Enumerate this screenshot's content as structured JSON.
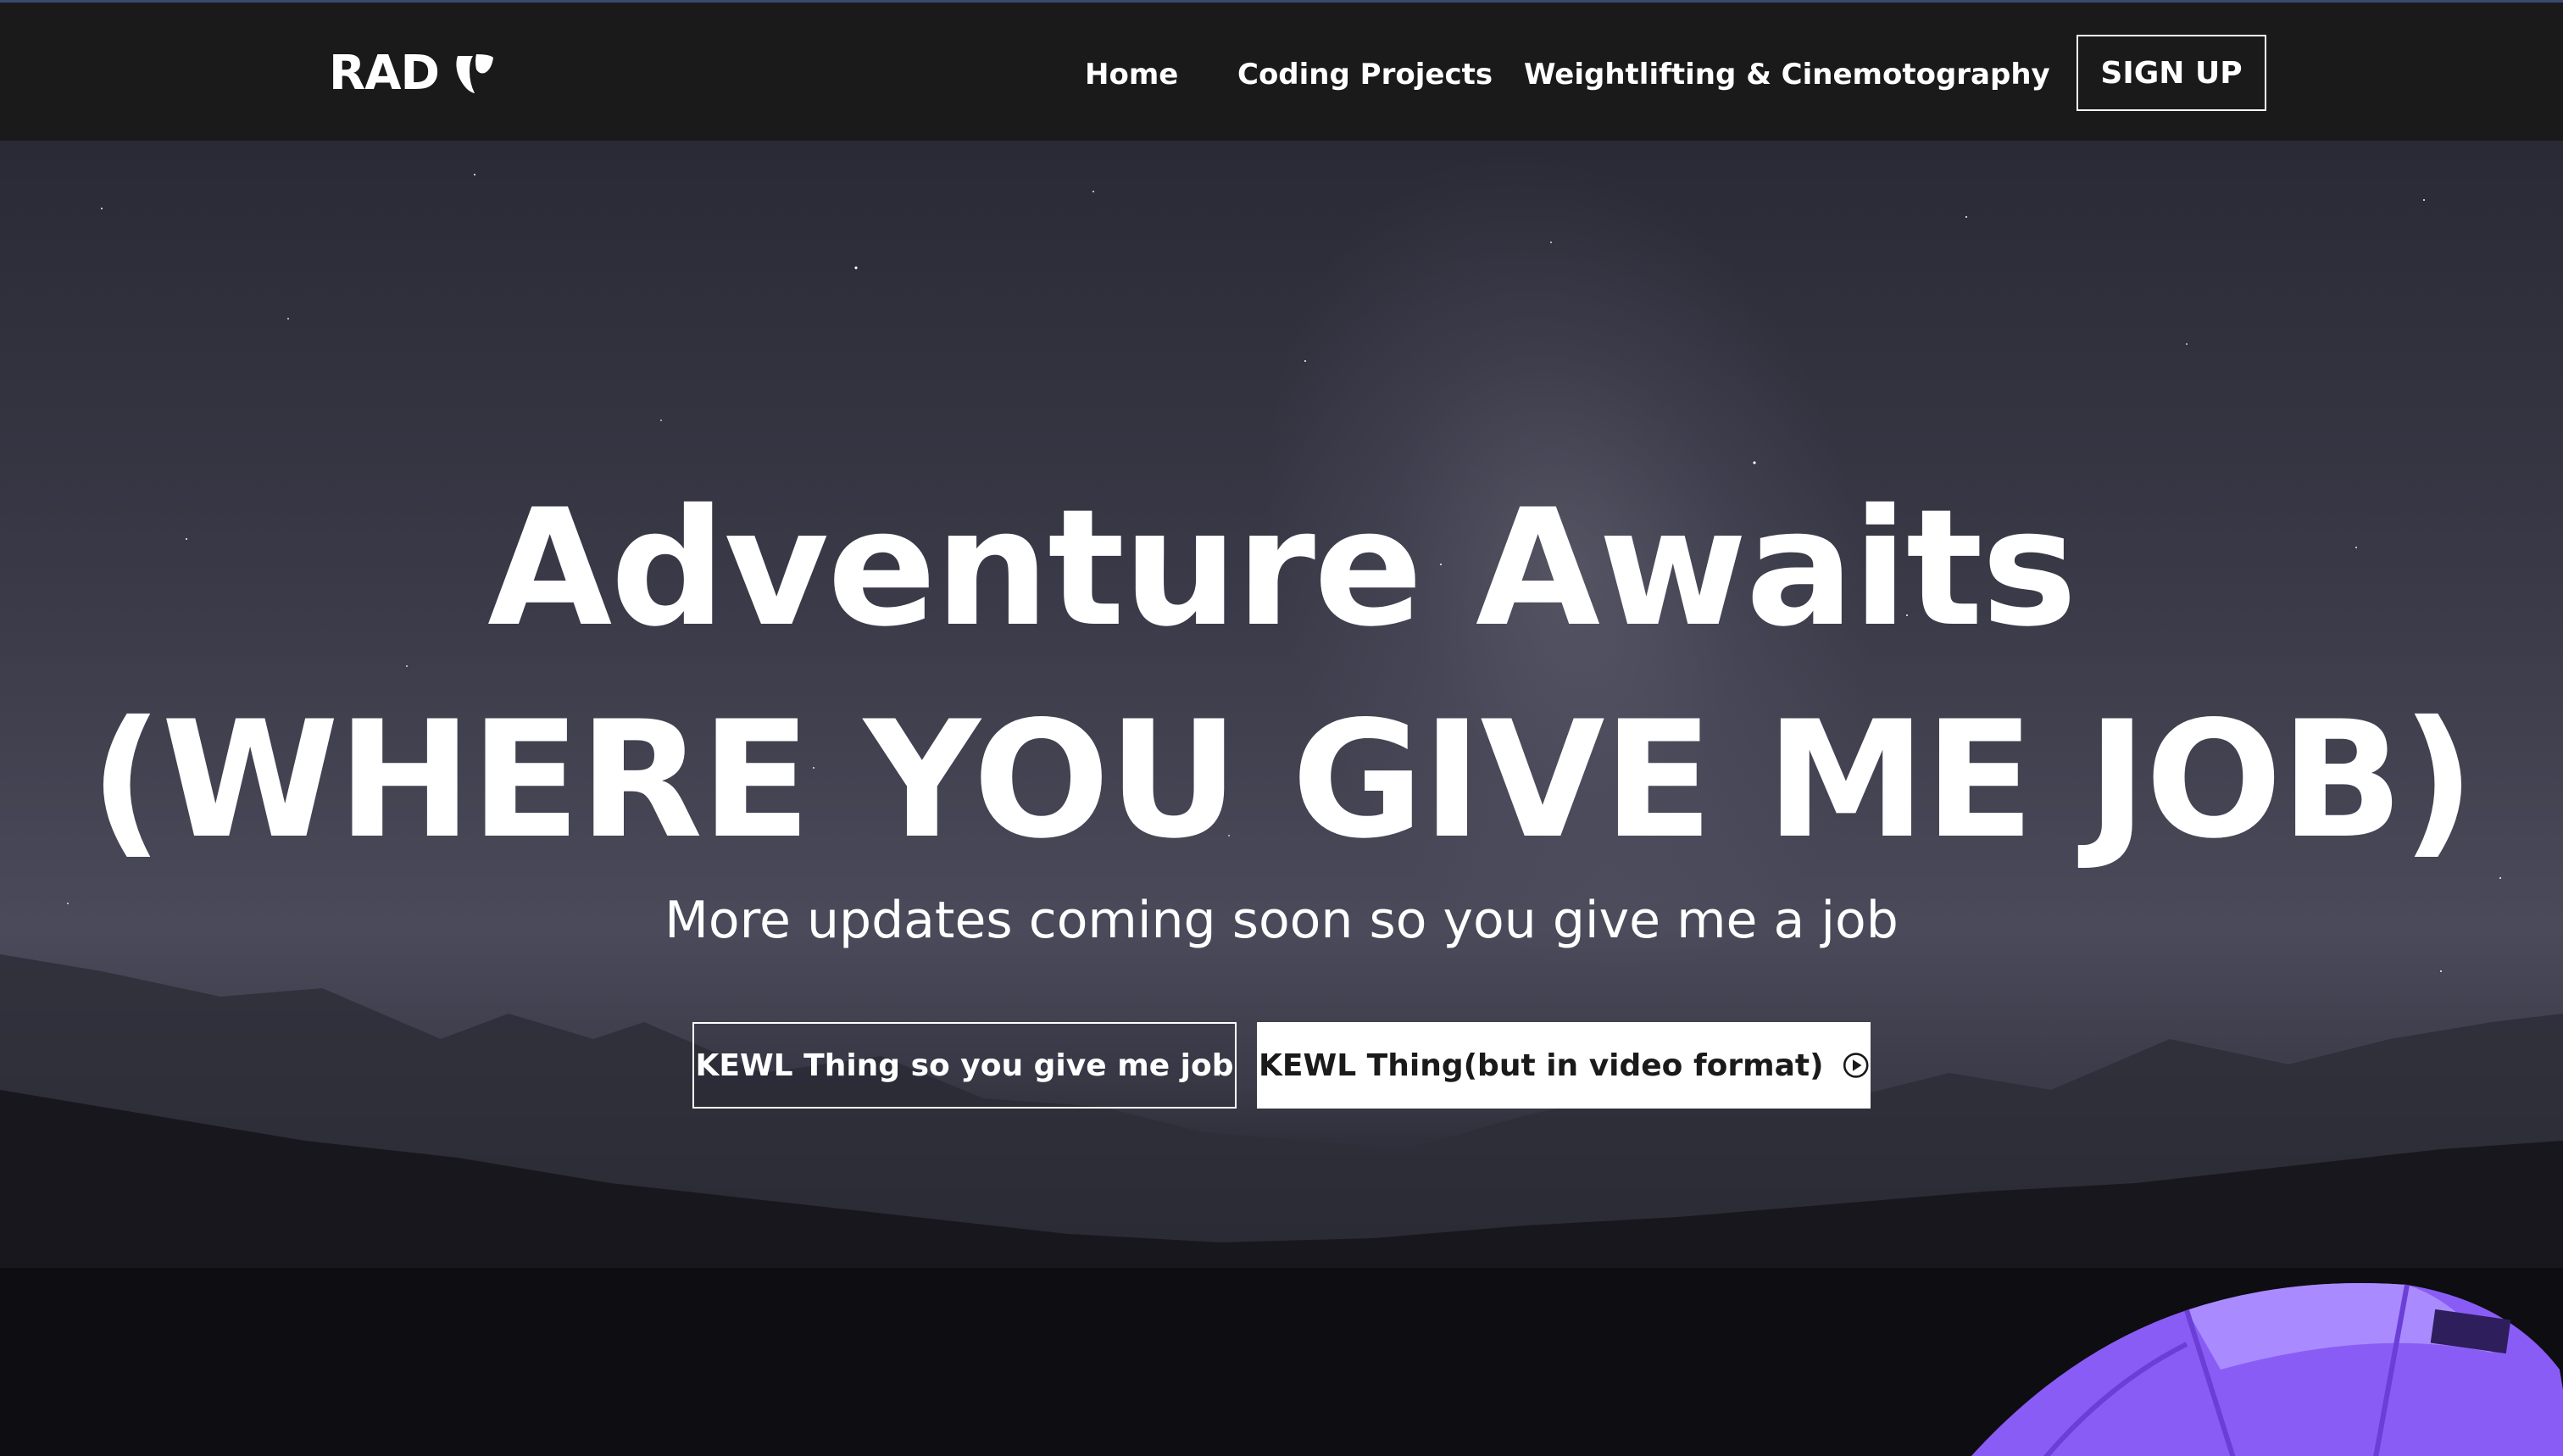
{
  "navbar": {
    "logo_text": "RAD",
    "logo_icon": "typo3-logo-icon",
    "links": [
      "Home",
      "Coding Projects",
      "Weightlifting & Cinemotography"
    ],
    "signup_label": "SIGN UP"
  },
  "hero": {
    "title_line1": "Adventure Awaits",
    "title_line2": "(WHERE YOU GIVE ME JOB)",
    "subtitle": "More updates coming soon so you give me a job",
    "primary_button_label": "KEWL Thing so you give me job",
    "video_button_label": "KEWL Thing(but in video format)",
    "video_button_icon": "play-circle-icon"
  },
  "colors": {
    "navbar_bg": "#1a1a1a",
    "text": "#ffffff",
    "tent": "#8a5cf6"
  }
}
